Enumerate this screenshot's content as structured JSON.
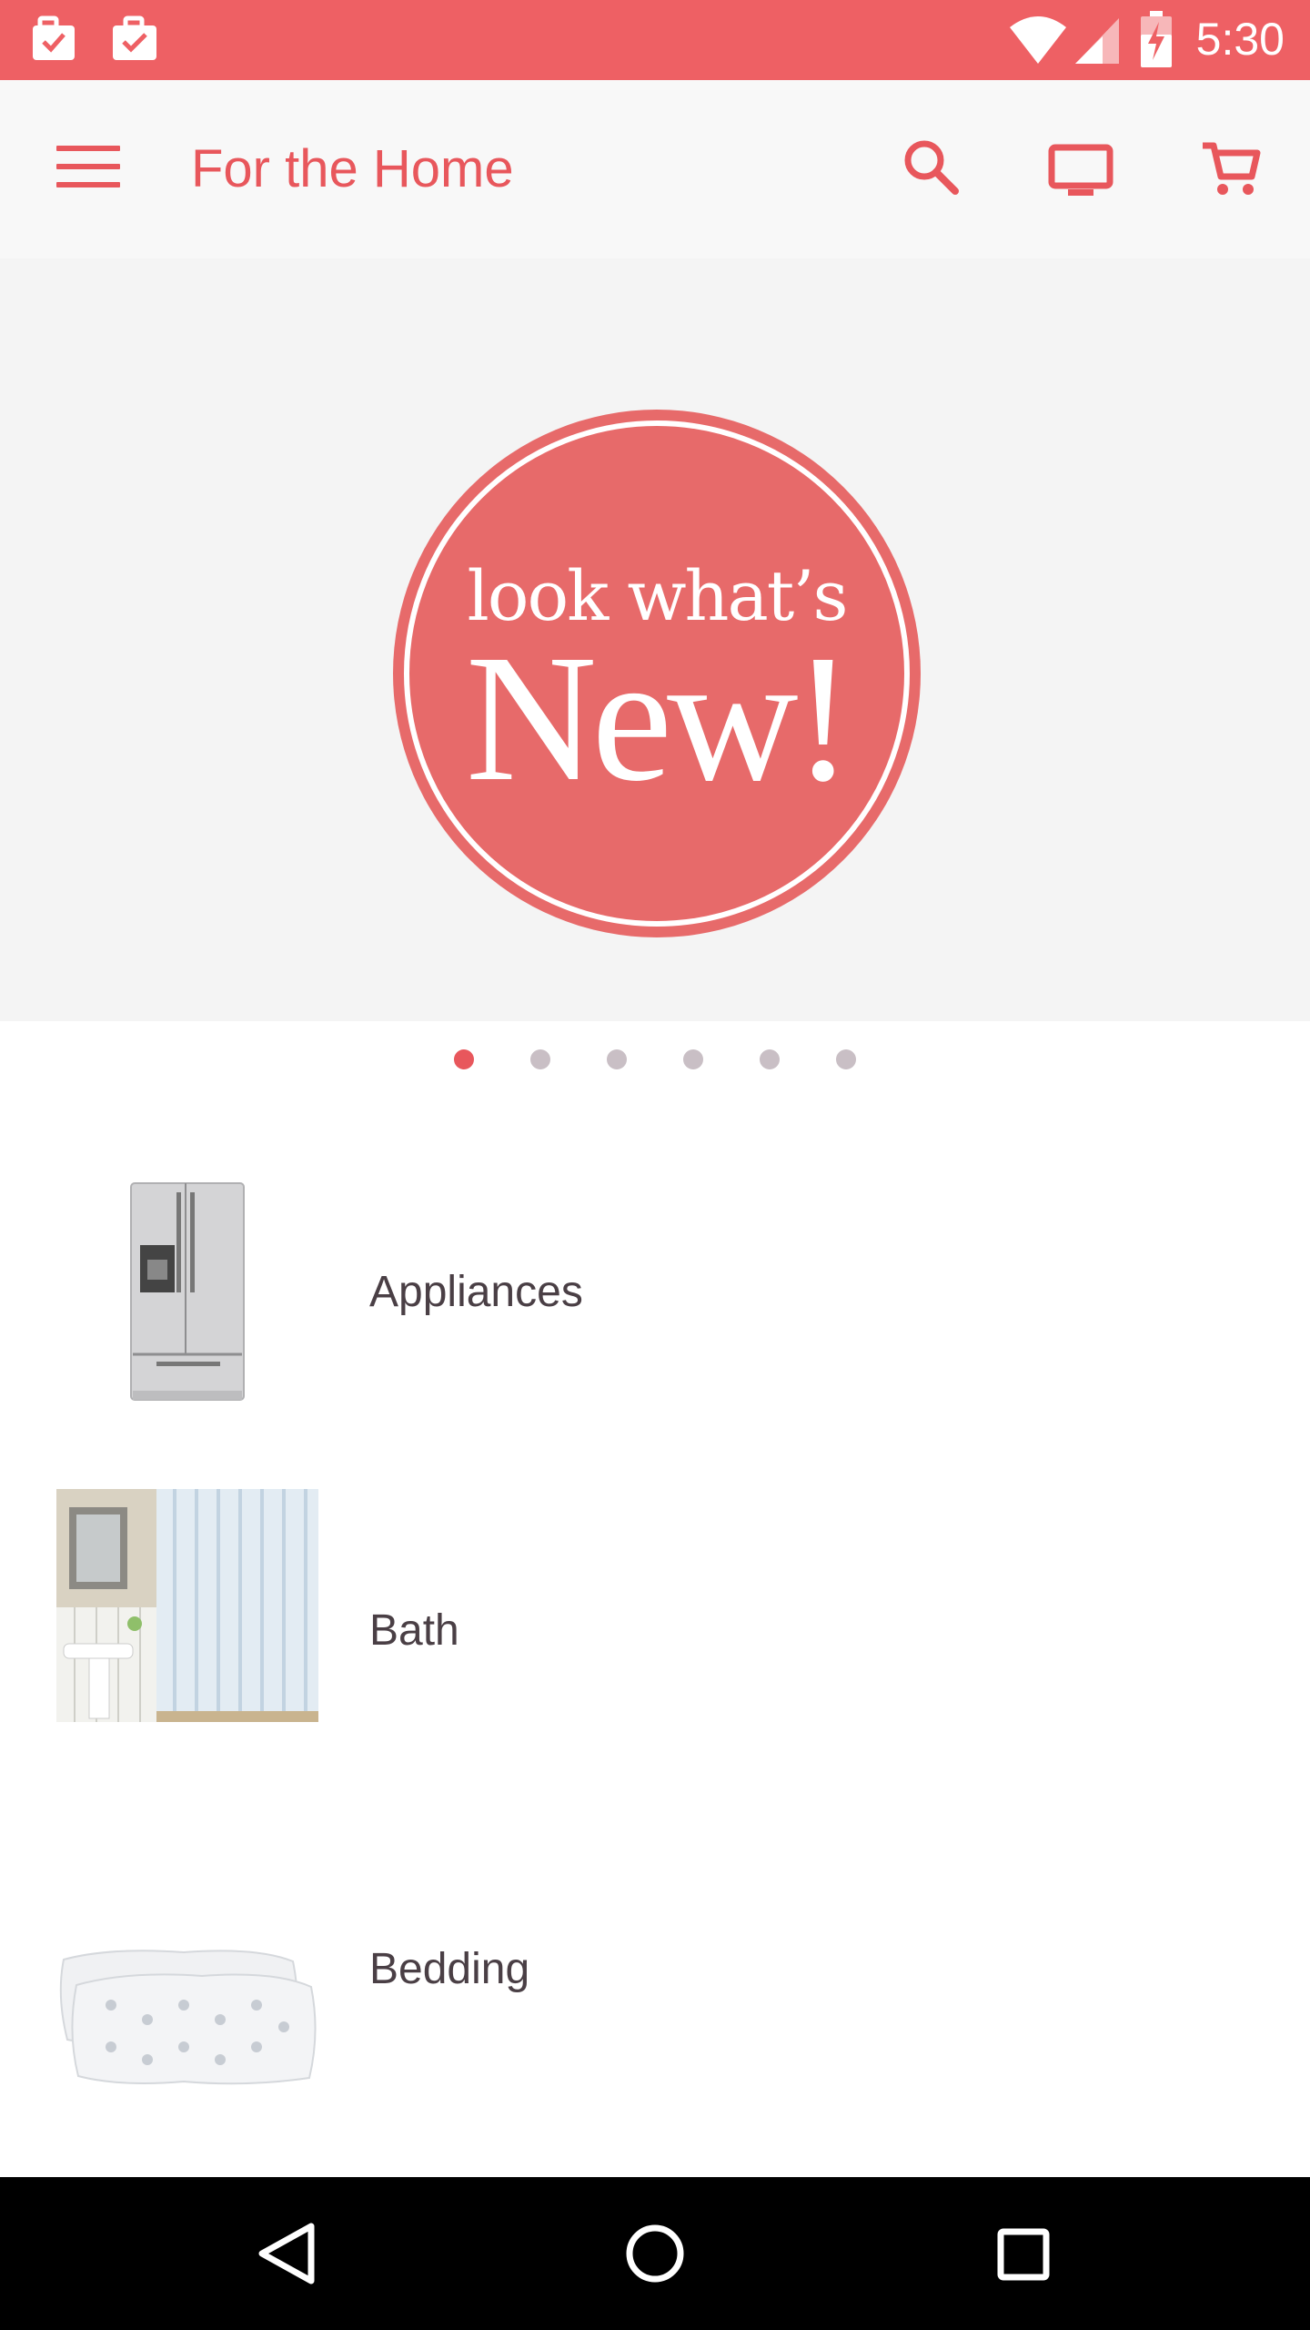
{
  "status_bar": {
    "time": "5:30",
    "icons": [
      "briefcase-check-icon",
      "briefcase-check-icon",
      "wifi-icon",
      "signal-icon",
      "battery-charging-icon"
    ]
  },
  "app_bar": {
    "title": "For the Home",
    "icons": [
      "menu-icon",
      "search-icon",
      "tv-icon",
      "cart-icon"
    ]
  },
  "banner": {
    "badge_line1": "look what’s",
    "badge_line2": "New!",
    "slide_count": 6,
    "active_slide": 1
  },
  "categories": [
    {
      "label": "Appliances",
      "thumb": "refrigerator-image"
    },
    {
      "label": "Bath",
      "thumb": "bath-mirror-curtain-image"
    },
    {
      "label": "Bedding",
      "thumb": "pillows-image"
    }
  ],
  "colors": {
    "accent": "#e8575c",
    "status_bar": "#ee6064",
    "badge": "#e76a6a",
    "text": "#4a3f45"
  },
  "nav_bar": {
    "icons": [
      "back-icon",
      "home-icon",
      "recents-icon"
    ]
  }
}
